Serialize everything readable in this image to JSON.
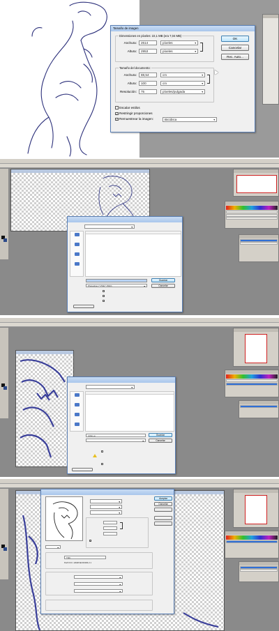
{
  "image_size_dialog": {
    "title": "Tamaño de imagen",
    "pixel_dimensions_label": "Dimensiones en píxeles: 22,1 MB (era 7,04 MB)",
    "width_label": "Anchura:",
    "width_value": "2614",
    "width_unit": "píxeles",
    "height_label": "Altura:",
    "height_value": "2953",
    "height_unit": "píxeles",
    "document_size_label": "Tamaño del documento:",
    "doc_width_label": "Anchura:",
    "doc_width_value": "88,54",
    "doc_width_unit": "cm",
    "doc_height_label": "Altura:",
    "doc_height_value": "100",
    "doc_height_unit": "cm",
    "resolution_label": "Resolución:",
    "resolution_value": "75",
    "resolution_unit": "píxeles/pulgada",
    "scale_styles": "Escalar estilos",
    "constrain_proportions": "Restringir proporciones",
    "resample": "Remuestrear la imagen:",
    "resample_method": "Bicúbica",
    "ok_button": "OK",
    "cancel_button": "Cancelar",
    "auto_button": "Rec. Auto..."
  },
  "save_dialog_2": {
    "file_type": "Photoshop (*.PSD;*.PDD)",
    "save_button": "Guardar",
    "cancel_button": "Cancelar"
  },
  "save_dialog_3": {
    "file_name": "ti-Rex-a",
    "save_button": "Guardar",
    "cancel_button": "Cancelar"
  },
  "save_for_web": {
    "format_value": "TIFF",
    "profile_value": "Perfil ICC: sRGB IEC61966-2.1",
    "ok_button": "Aceptar",
    "cancel_button": "Cancelar"
  },
  "accent": "#2f6fd6"
}
